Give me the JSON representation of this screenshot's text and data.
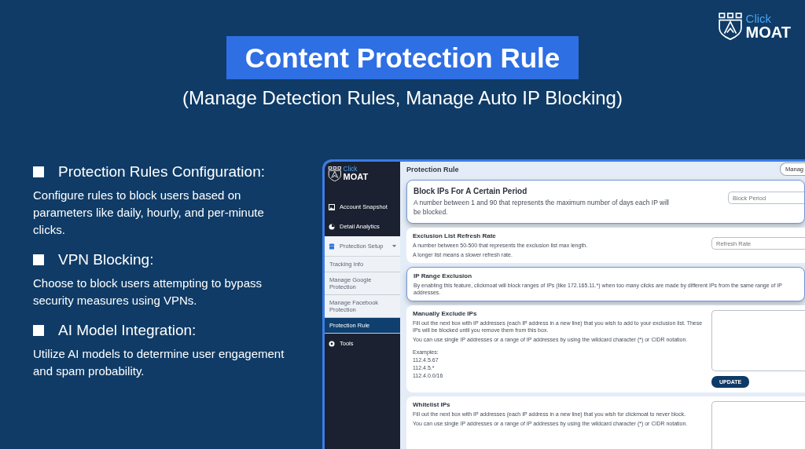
{
  "title": "Content Protection Rule",
  "subtitle": "(Manage Detection Rules, Manage Auto IP Blocking)",
  "logo": {
    "top": "Click",
    "bottom": "MOAT"
  },
  "features": [
    {
      "heading": "Protection Rules Configuration:",
      "text": "Configure rules to block users based on parameters like daily, hourly, and per-minute clicks."
    },
    {
      "heading": "VPN Blocking:",
      "text": "Choose to block users attempting to bypass security measures using VPNs."
    },
    {
      "heading": "AI Model Integration:",
      "text": "Utilize AI models to determine user engagement and spam probability."
    }
  ],
  "app": {
    "logo": {
      "top": "Click",
      "bottom": "MOAT"
    },
    "sidebar": [
      {
        "kind": "main",
        "label": "Account Snapshot",
        "selected": false
      },
      {
        "kind": "main",
        "label": "Detail Analytics",
        "selected": false
      },
      {
        "kind": "group",
        "label": "Protection Setup",
        "expanded": true,
        "children": [
          {
            "label": "Tracking Info",
            "selected": false
          },
          {
            "label": "Manage Google Protection",
            "selected": false
          },
          {
            "label": "Manage Facebook Protection",
            "selected": false
          },
          {
            "label": "Protection Rule",
            "selected": true
          }
        ]
      },
      {
        "kind": "main",
        "label": "Tools",
        "selected": false
      }
    ],
    "page_title": "Protection Rule",
    "header_button": "Manag",
    "cards": [
      {
        "kind": "input",
        "highlighted": true,
        "title": "Block IPs For A Certain Period",
        "lines": [
          "A number between 1 and 90 that represents the maximum number of days each IP will be blocked."
        ],
        "placeholder": "Block Period"
      },
      {
        "kind": "input",
        "highlighted": false,
        "title": "Exclusion List Refresh Rate",
        "lines": [
          "A number between 50-500 that represents the exclusion list max length.",
          "A longer list means a slower refresh rate."
        ],
        "placeholder": "Refresh Rate"
      },
      {
        "kind": "plain",
        "highlighted": true,
        "title": "IP Range Exclusion",
        "lines": [
          "By enabling this feature, clickmoat will block ranges of IPs (like 172.165.11.*) when too many clicks are made by different IPs from the same range of IP addresses."
        ]
      },
      {
        "kind": "textarea",
        "highlighted": false,
        "title": "Manually Exclude IPs",
        "lines": [
          "Fill out the next box with IP addresses (each IP address in a new line) that you wish to add to your exclusion list. These IPs will be blocked until you remove them from this box.",
          "You can use single IP addresses or a range of IP addresses by using the wildcard character (*) or CIDR notation."
        ],
        "examples_label": "Examples:",
        "examples": [
          "112.4.5.67",
          "112.4.5.*",
          "112.4.0.0/16"
        ],
        "button": "UPDATE"
      },
      {
        "kind": "textarea",
        "highlighted": false,
        "title": "Whitelist IPs",
        "lines": [
          "Fill out the next box with IP addresses (each IP address in a new line) that you wish for clickmoat to never block.",
          "You can use single IP addresses or a range of IP addresses by using the wildcard character (*) or CIDR notation."
        ]
      }
    ]
  }
}
